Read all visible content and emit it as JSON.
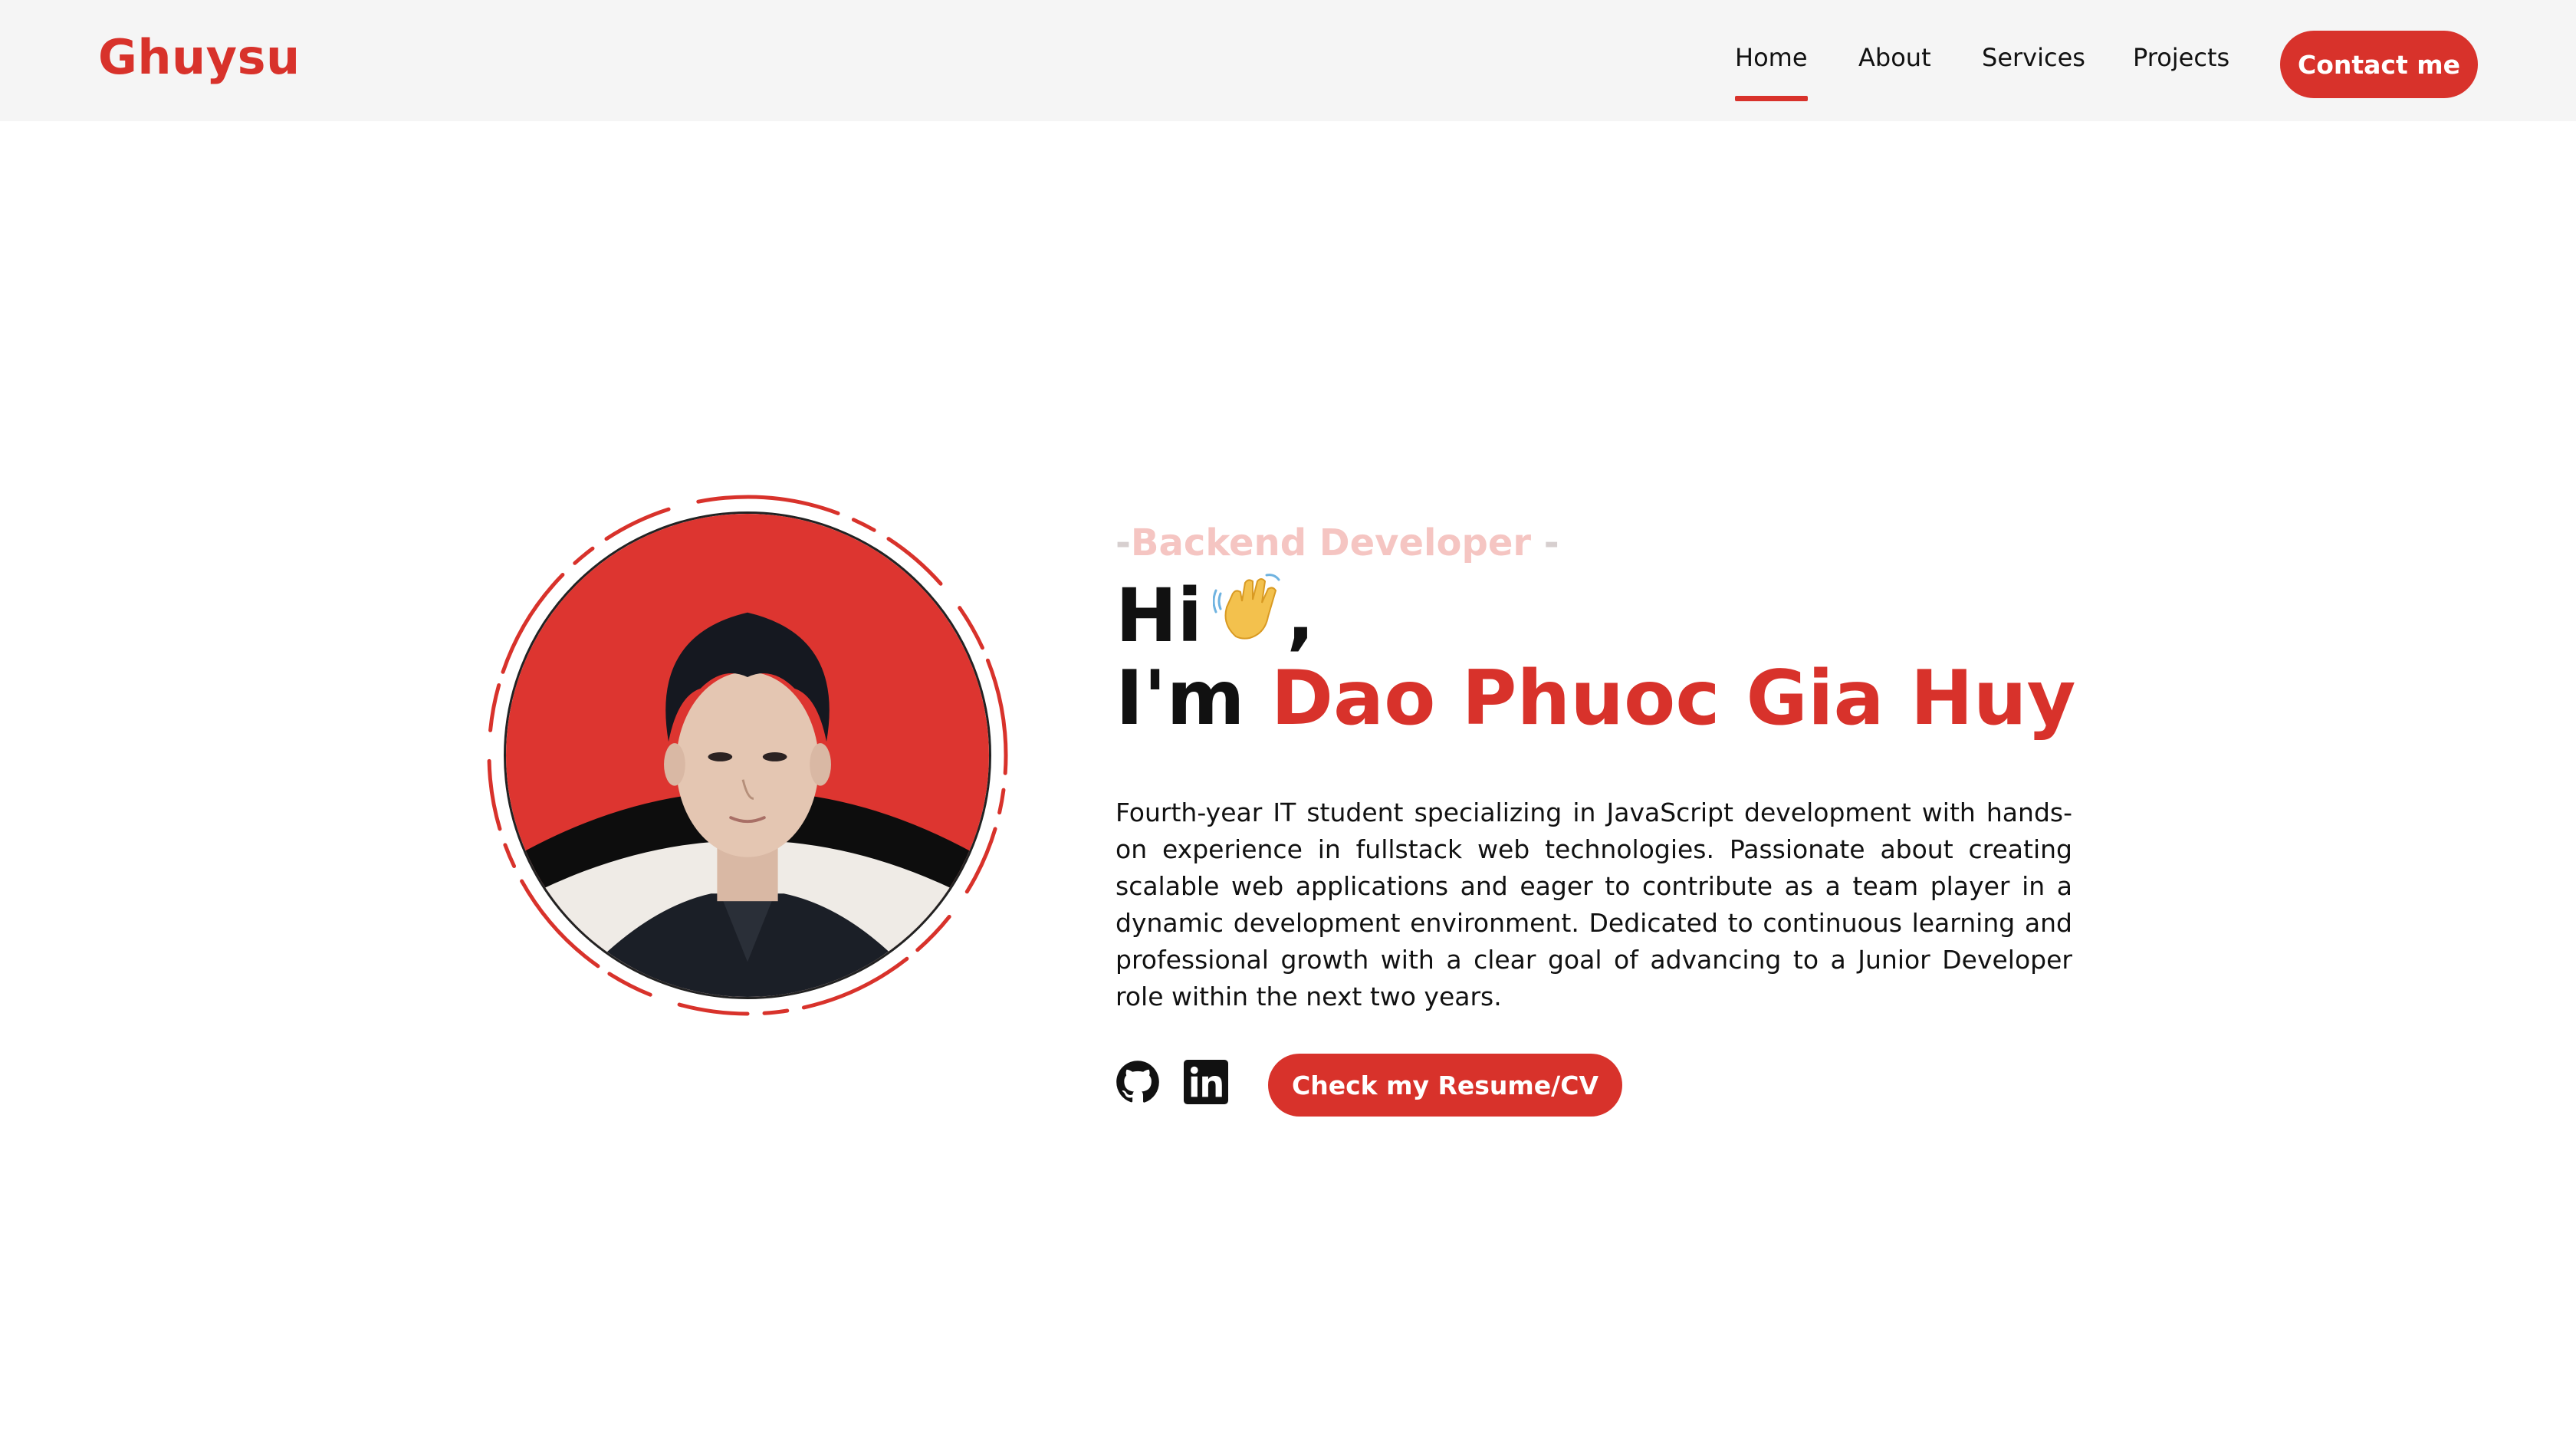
{
  "header": {
    "logo": "Ghuysu",
    "nav": [
      {
        "label": "Home",
        "active": true
      },
      {
        "label": "About",
        "active": false
      },
      {
        "label": "Services",
        "active": false
      },
      {
        "label": "Projects",
        "active": false
      }
    ],
    "contact_label": "Contact me"
  },
  "hero": {
    "role_dash_left": "-",
    "role": "Backend Developer",
    "role_dash_right": " -",
    "greeting": "Hi",
    "greeting_suffix": ",",
    "intro_prefix": "I'm ",
    "name": "Dao Phuoc Gia Huy",
    "description": "Fourth-year IT student specializing in JavaScript development with hands-on experience in fullstack web technologies. Passionate about creating scalable web applications and eager to contribute as a team player in a dynamic development environment. Dedicated to continuous learning and professional growth with a clear goal of advancing to a Junior Developer role within the next two years.",
    "cv_button": "Check my Resume/CV",
    "social_icons": [
      "github-icon",
      "linkedin-icon"
    ],
    "greeting_icon": "waving-hand-icon"
  },
  "colors": {
    "accent": "#d8322b",
    "role_text": "#f5c5c2",
    "header_bg": "#f5f5f5"
  }
}
